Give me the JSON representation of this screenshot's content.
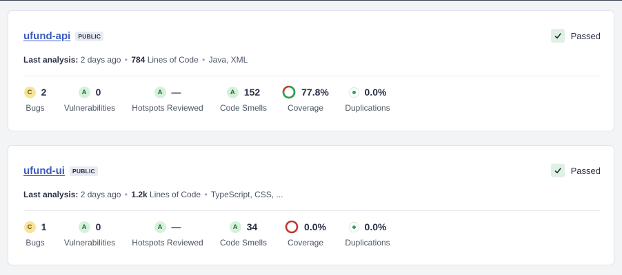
{
  "projects": [
    {
      "name": "ufund-api",
      "visibility": "PUBLIC",
      "quality_gate": "Passed",
      "meta": {
        "analysis_label": "Last analysis:",
        "analysis_time": "2 days ago",
        "sep1": "•",
        "loc_value": "784",
        "loc_label": "Lines of Code",
        "sep2": "•",
        "languages": "Java, XML"
      },
      "metrics": {
        "bugs": {
          "rating": "C",
          "value": "2",
          "label": "Bugs"
        },
        "vulnerabilities": {
          "rating": "A",
          "value": "0",
          "label": "Vulnerabilities"
        },
        "hotspots": {
          "rating": "A",
          "value": "—",
          "label": "Hotspots Reviewed"
        },
        "code_smells": {
          "rating": "A",
          "value": "152",
          "label": "Code Smells"
        },
        "coverage": {
          "value": "77.8%",
          "label": "Coverage",
          "percent": 77.8
        },
        "duplications": {
          "value": "0.0%",
          "label": "Duplications"
        }
      }
    },
    {
      "name": "ufund-ui",
      "visibility": "PUBLIC",
      "quality_gate": "Passed",
      "meta": {
        "analysis_label": "Last analysis:",
        "analysis_time": "2 days ago",
        "sep1": "•",
        "loc_value": "1.2k",
        "loc_label": "Lines of Code",
        "sep2": "•",
        "languages": "TypeScript, CSS, ..."
      },
      "metrics": {
        "bugs": {
          "rating": "C",
          "value": "1",
          "label": "Bugs"
        },
        "vulnerabilities": {
          "rating": "A",
          "value": "0",
          "label": "Vulnerabilities"
        },
        "hotspots": {
          "rating": "A",
          "value": "—",
          "label": "Hotspots Reviewed"
        },
        "code_smells": {
          "rating": "A",
          "value": "34",
          "label": "Code Smells"
        },
        "coverage": {
          "value": "0.0%",
          "label": "Coverage",
          "percent": 0.0
        },
        "duplications": {
          "value": "0.0%",
          "label": "Duplications"
        }
      }
    }
  ],
  "colors": {
    "link": "#3a5bbd",
    "coverage_good": "#29a356",
    "coverage_bad": "#c0392b",
    "passed_bg": "#dff1e3",
    "rating_a_bg": "#d6f1db",
    "rating_c_bg": "#f7e39b"
  },
  "icons": {
    "quality_gate": "check-icon",
    "coverage": "coverage-ring-icon",
    "duplications": "duplication-dot-icon"
  }
}
